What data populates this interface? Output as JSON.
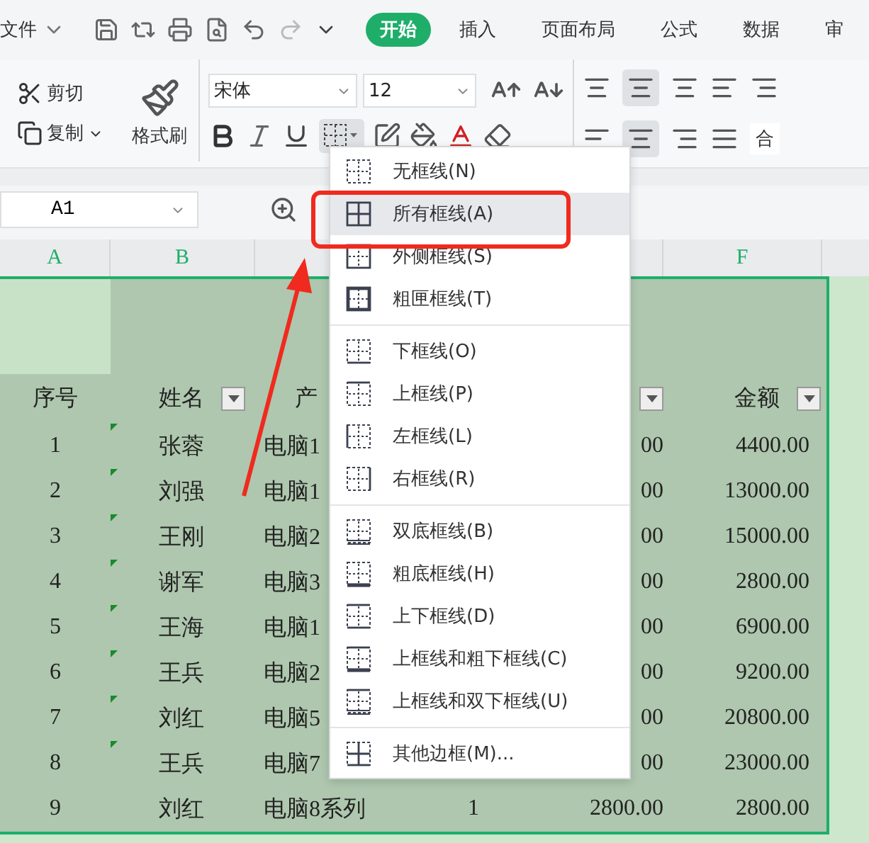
{
  "menu_bar": {
    "file": "文件",
    "tabs": [
      {
        "label": "开始",
        "selected": true
      },
      {
        "label": "插入",
        "selected": false
      },
      {
        "label": "页面布局",
        "selected": false
      },
      {
        "label": "公式",
        "selected": false
      },
      {
        "label": "数据",
        "selected": false
      },
      {
        "label": "审",
        "selected": false
      }
    ]
  },
  "ribbon": {
    "cut": "剪切",
    "copy": "复制",
    "format_painter": "格式刷",
    "font_name": "宋体",
    "font_size": "12",
    "merge": "合"
  },
  "formula_bar": {
    "cell_ref": "A1"
  },
  "column_headers": [
    "A",
    "B",
    "F"
  ],
  "sheet": {
    "header": [
      {
        "text": "序号",
        "filter": false
      },
      {
        "text": "姓名",
        "filter": true
      },
      {
        "text": "产",
        "filter": false
      },
      {
        "filter": false
      },
      {
        "filter": true
      },
      {
        "text": "金额",
        "filter": true
      }
    ],
    "rows": [
      {
        "index": "1",
        "name": "张蓉",
        "product": "电脑1",
        "column_5": "00",
        "amount": "4400.00",
        "flag": true
      },
      {
        "index": "2",
        "name": "刘强",
        "product": "电脑1",
        "column_5": "00",
        "amount": "13000.00",
        "flag": true
      },
      {
        "index": "3",
        "name": "王刚",
        "product": "电脑2",
        "column_5": "00",
        "amount": "15000.00",
        "flag": true
      },
      {
        "index": "4",
        "name": "谢军",
        "product": "电脑3",
        "column_5": "00",
        "amount": "2800.00",
        "flag": true
      },
      {
        "index": "5",
        "name": "王海",
        "product": "电脑1",
        "column_5": "00",
        "amount": "6900.00",
        "flag": true
      },
      {
        "index": "6",
        "name": "王兵",
        "product": "电脑2",
        "column_5": "00",
        "amount": "9200.00",
        "flag": true
      },
      {
        "index": "7",
        "name": "刘红",
        "product": "电脑5",
        "column_5": "00",
        "amount": "20800.00",
        "flag": true
      },
      {
        "index": "8",
        "name": "王兵",
        "product": "电脑7",
        "column_5": "00",
        "amount": "23000.00",
        "flag": true
      },
      {
        "index": "9",
        "name": "刘红",
        "product": "电脑8系列",
        "column_4": "1",
        "column_5": "2800.00",
        "amount": "2800.00",
        "flag": false
      }
    ]
  },
  "border_menu": {
    "sections": [
      [
        {
          "label": "无框线(N)",
          "kind": "none",
          "selected": false
        },
        {
          "label": "所有框线(A)",
          "kind": "all",
          "selected": true
        },
        {
          "label": "外侧框线(S)",
          "kind": "outside",
          "selected": false
        },
        {
          "label": "粗匣框线(T)",
          "kind": "thick",
          "selected": false
        }
      ],
      [
        {
          "label": "下框线(O)",
          "kind": "bottom",
          "selected": false
        },
        {
          "label": "上框线(P)",
          "kind": "top",
          "selected": false
        },
        {
          "label": "左框线(L)",
          "kind": "left",
          "selected": false
        },
        {
          "label": "右框线(R)",
          "kind": "right",
          "selected": false
        }
      ],
      [
        {
          "label": "双底框线(B)",
          "kind": "double-bottom",
          "selected": false
        },
        {
          "label": "粗底框线(H)",
          "kind": "thick-bottom",
          "selected": false
        },
        {
          "label": "上下框线(D)",
          "kind": "top-bottom",
          "selected": false
        },
        {
          "label": "上框线和粗下框线(C)",
          "kind": "top-thick-bottom",
          "selected": false
        },
        {
          "label": "上框线和双下框线(U)",
          "kind": "top-double-bottom",
          "selected": false
        }
      ],
      [
        {
          "label": "其他边框(M)...",
          "kind": "more",
          "selected": false
        }
      ]
    ]
  }
}
